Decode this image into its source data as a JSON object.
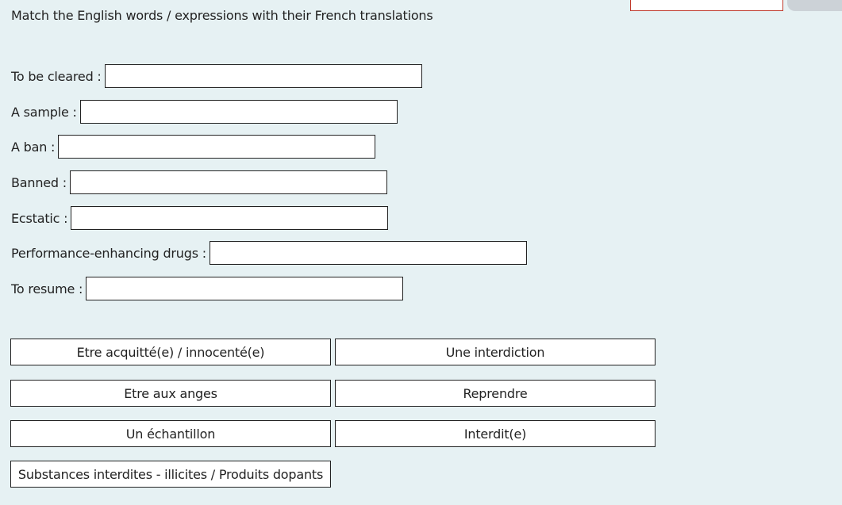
{
  "instructions": "Match the English words / expressions with their French translations",
  "questions": [
    {
      "label": "To be cleared :",
      "value": ""
    },
    {
      "label": "A sample :",
      "value": ""
    },
    {
      "label": "A ban :",
      "value": ""
    },
    {
      "label": "Banned :",
      "value": ""
    },
    {
      "label": "Ecstatic :",
      "value": ""
    },
    {
      "label": "Performance-enhancing drugs :",
      "value": ""
    },
    {
      "label": "To resume :",
      "value": ""
    }
  ],
  "answers": [
    "Etre acquitté(e) / innocenté(e)",
    "Une interdiction",
    "Etre aux anges",
    "Reprendre",
    "Un échantillon",
    "Interdit(e)",
    "Substances interdites - illicites / Produits dopants"
  ]
}
